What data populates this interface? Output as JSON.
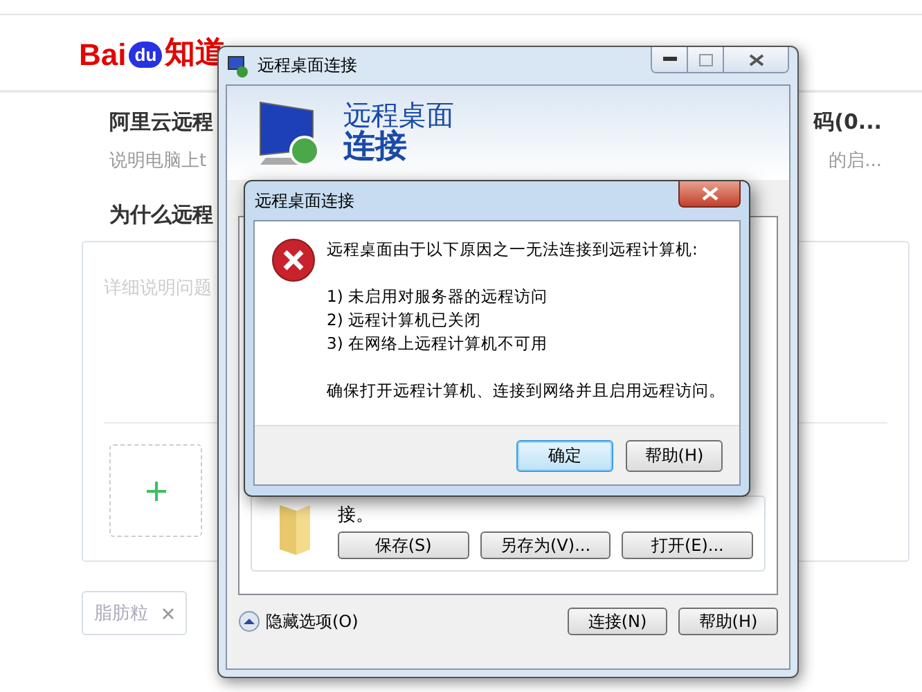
{
  "page": {
    "logo": {
      "latin": "Bai",
      "badge": "du",
      "cjk": "知道"
    },
    "questions": [
      {
        "title_left": "阿里云远程",
        "title_right": "码(0...",
        "snippet_left": "说明电脑上t",
        "snippet_right": "的启..."
      },
      {
        "title_left": "为什么远程"
      }
    ],
    "ask_box": {
      "placeholder": "详细说明问题"
    },
    "tags": [
      {
        "label": "脂肪粒"
      }
    ]
  },
  "main_window": {
    "title": "远程桌面连接",
    "header": [
      "远程桌面",
      "连接"
    ],
    "save_text": "接。",
    "group_buttons": [
      "保存(S)",
      "另存为(V)...",
      "打开(E)..."
    ],
    "options_toggle": "隐藏选项(O)",
    "buttons": [
      "连接(N)",
      "帮助(H)"
    ]
  },
  "error_dialog": {
    "title": "远程桌面连接",
    "message": "远程桌面由于以下原因之一无法连接到远程计算机:",
    "reasons": [
      "1) 未启用对服务器的远程访问",
      "2) 远程计算机已关闭",
      "3) 在网络上远程计算机不可用"
    ],
    "advice": "确保打开远程计算机、连接到网络并且启用远程访问。",
    "buttons": [
      {
        "label": "确定",
        "default": true
      },
      {
        "label": "帮助(H)",
        "default": false
      }
    ]
  }
}
